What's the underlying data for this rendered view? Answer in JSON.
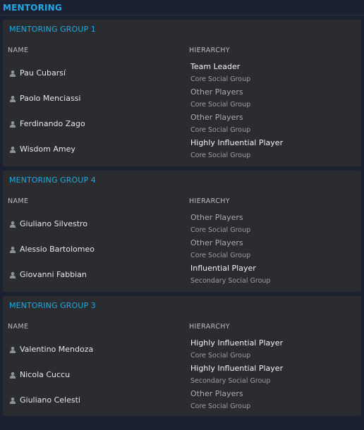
{
  "section": {
    "title": "MENTORING"
  },
  "columns": {
    "name": "NAME",
    "hierarchy": "HIERARCHY"
  },
  "groups": [
    {
      "title": "MENTORING GROUP 1",
      "members": [
        {
          "name": "Pau Cubarsí",
          "role": "Team Leader",
          "social_group": "Core Social Group"
        },
        {
          "name": "Paolo Menciassi",
          "role": "Other Players",
          "social_group": "Core Social Group"
        },
        {
          "name": "Ferdinando Zago",
          "role": "Other Players",
          "social_group": "Core Social Group"
        },
        {
          "name": "Wisdom Amey",
          "role": "Highly Influential Player",
          "social_group": "Core Social Group"
        }
      ]
    },
    {
      "title": "MENTORING GROUP 4",
      "members": [
        {
          "name": "Giuliano Silvestro",
          "role": "Other Players",
          "social_group": "Core Social Group"
        },
        {
          "name": "Alessio Bartolomeo",
          "role": "Other Players",
          "social_group": "Core Social Group"
        },
        {
          "name": "Giovanni Fabbian",
          "role": "Influential Player",
          "social_group": "Secondary Social Group"
        }
      ]
    },
    {
      "title": "MENTORING GROUP 3",
      "members": [
        {
          "name": "Valentino Mendoza",
          "role": "Highly Influential Player",
          "social_group": "Core Social Group"
        },
        {
          "name": "Nicola Cuccu",
          "role": "Highly Influential Player",
          "social_group": "Secondary Social Group"
        },
        {
          "name": "Giuliano Celesti",
          "role": "Other Players",
          "social_group": "Core Social Group"
        }
      ]
    }
  ],
  "colors": {
    "accent": "#22a9e4",
    "background": "#1c2132",
    "panel": "#2a2c30",
    "text": "#e6e8ec",
    "muted": "#9a9ea6"
  },
  "icons": {
    "player": "person-icon"
  }
}
